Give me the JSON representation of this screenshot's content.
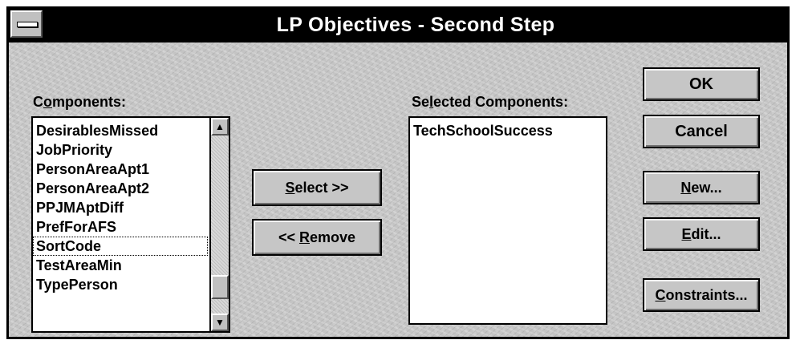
{
  "window": {
    "title": "LP Objectives - Second Step"
  },
  "components": {
    "label_before": "C",
    "label_mnemonic": "o",
    "label_after": "mponents:",
    "items": [
      "DesirablesMissed",
      "JobPriority",
      "PersonAreaApt1",
      "PersonAreaApt2",
      "PPJMAptDiff",
      "PrefForAFS",
      "SortCode",
      "TestAreaMin",
      "TypePerson"
    ],
    "focused_item": "SortCode"
  },
  "selected_components": {
    "label_before": "Se",
    "label_mnemonic": "l",
    "label_after": "ected Components:",
    "items": [
      "TechSchoolSuccess"
    ]
  },
  "buttons": {
    "select": {
      "mnemonic": "S",
      "rest": "elect >>"
    },
    "remove": {
      "prefix": "<< ",
      "mnemonic": "R",
      "rest": "emove"
    },
    "ok": {
      "label": "OK"
    },
    "cancel": {
      "label": "Cancel"
    },
    "new": {
      "mnemonic": "N",
      "rest": "ew..."
    },
    "edit": {
      "mnemonic": "E",
      "rest": "dit..."
    },
    "constraints": {
      "mnemonic": "C",
      "rest": "onstraints..."
    }
  },
  "scrollbar": {
    "up_icon": "scroll-up-arrow",
    "down_icon": "scroll-down-arrow",
    "up_glyph": "▲",
    "down_glyph": "▼"
  }
}
